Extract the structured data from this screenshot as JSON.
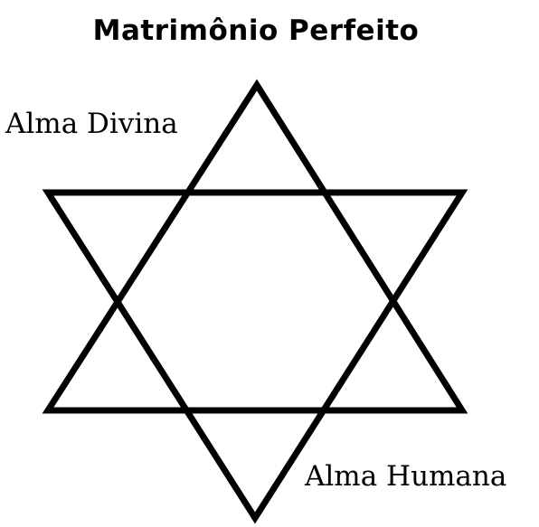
{
  "title": "Matrimônio Perfeito",
  "labels": {
    "upper_triangle": "Alma Divina",
    "lower_triangle": "Alma Humana"
  },
  "colors": {
    "stroke": "#000000",
    "background": "#ffffff",
    "text": "#000000"
  },
  "shape": "hexagram"
}
